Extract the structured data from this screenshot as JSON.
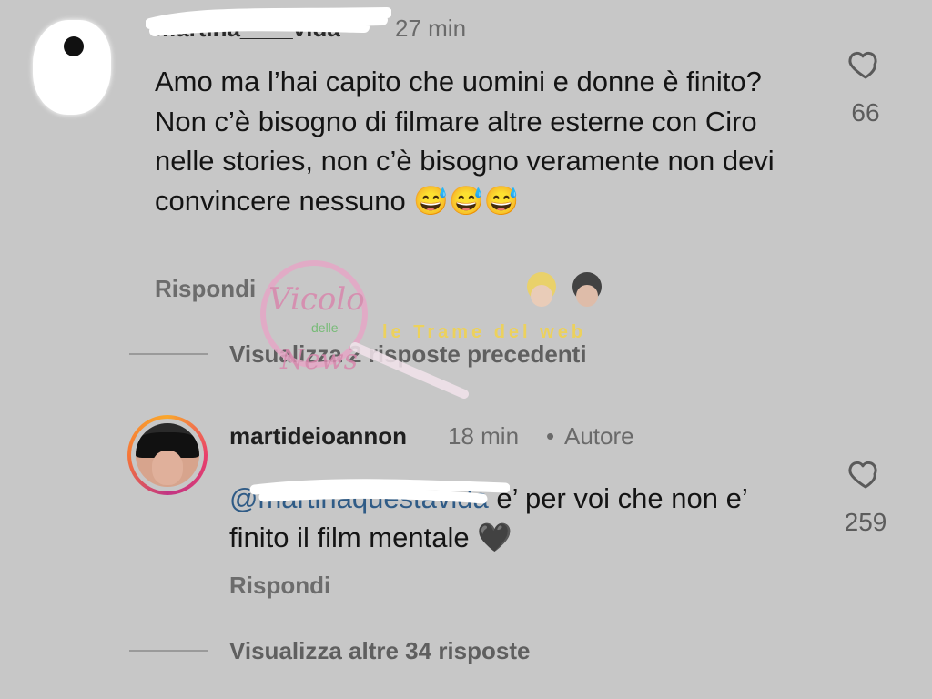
{
  "comment1": {
    "username": "martina____vida",
    "time": "27 min",
    "text": "Amo ma l’hai capito che uomini e donne è finito? Non c’è bisogno di filmare altre esterne con Ciro nelle stories, non c’è bisogno veramente non devi convincere nessuno",
    "emojis": "😅😅😅",
    "reply_label": "Rispondi",
    "likes": "66"
  },
  "replies_prev": {
    "label": "Visualizza 2 risposte precedenti"
  },
  "comment2": {
    "username": "martideioannon",
    "time": "18 min",
    "separator": "•",
    "author_badge": "Autore",
    "mention": "@martinaquestavida",
    "text": " e’ per voi che non e’ finito il film mentale ",
    "emoji": "🖤",
    "reply_label": "Rispondi",
    "likes": "259"
  },
  "replies_more": {
    "label": "Visualizza altre 34 risposte"
  },
  "watermark": {
    "line1": "Vicolo",
    "line2": "delle",
    "line3": "News",
    "tag": "le Trame del web"
  },
  "colors": {
    "background": "#c7c7c7",
    "mention": "#2f5b86",
    "text": "#141414",
    "muted": "#6a6a6a"
  }
}
